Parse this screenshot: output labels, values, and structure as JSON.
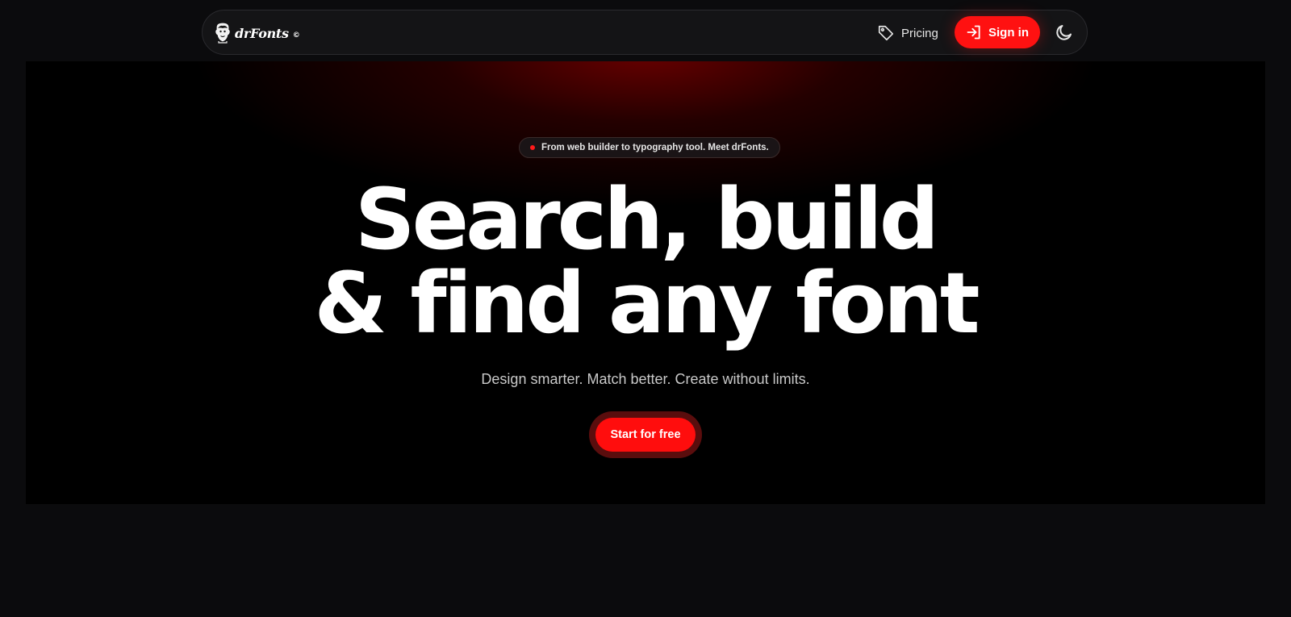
{
  "colors": {
    "accent": "#ff1111",
    "page_background": "#0b0b0d",
    "hero_background": "#000000",
    "nav_background": "#141416"
  },
  "nav": {
    "logo_text": "drFonts",
    "logo_symbol": "©",
    "logo_icon": "mascot-head-icon",
    "pricing_label": "Pricing",
    "pricing_icon": "tag-icon",
    "signin_label": "Sign in",
    "signin_icon": "sign-in-arrow-icon",
    "theme_icon": "moon-icon"
  },
  "hero": {
    "announcement": "From web builder to typography tool. Meet drFonts.",
    "headline_line1": "Search, build",
    "headline_line2": "& find any font",
    "subheadline": "Design smarter. Match better. Create without limits.",
    "cta_label": "Start for free"
  }
}
